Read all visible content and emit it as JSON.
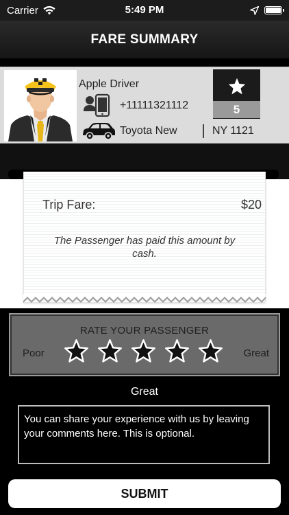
{
  "status_bar": {
    "carrier": "Carrier",
    "time": "5:49 PM"
  },
  "nav": {
    "title": "FARE SUMMARY"
  },
  "driver": {
    "name": "Apple Driver",
    "phone": "+11111321112",
    "car_model": "Toyota New",
    "plate": "NY 1121",
    "rating": "5"
  },
  "receipt": {
    "fare_label": "Trip Fare:",
    "fare_amount": "$20",
    "note": "The Passenger has paid this amount by cash."
  },
  "rate_panel": {
    "title": "RATE  YOUR PASSENGER",
    "poor_label": "Poor",
    "great_label": "Great",
    "stars_selected": 5,
    "stars_total": 5
  },
  "rating_text": "Great",
  "comment": {
    "placeholder": "You can share your experience with us by leaving your comments here. This is optional."
  },
  "submit_label": "SUBMIT",
  "colors": {
    "rating_box_bg": "#1b1b1b",
    "rating_value_bg": "#9a9a9a",
    "rate_panel_bg": "#6a6a6a",
    "star_fill": "#111111",
    "star_stroke": "#ffffff"
  },
  "icons": [
    "wifi-icon",
    "location-arrow-icon",
    "battery-icon",
    "driver-avatar",
    "phone-contact-icon",
    "car-icon",
    "star-icon"
  ]
}
